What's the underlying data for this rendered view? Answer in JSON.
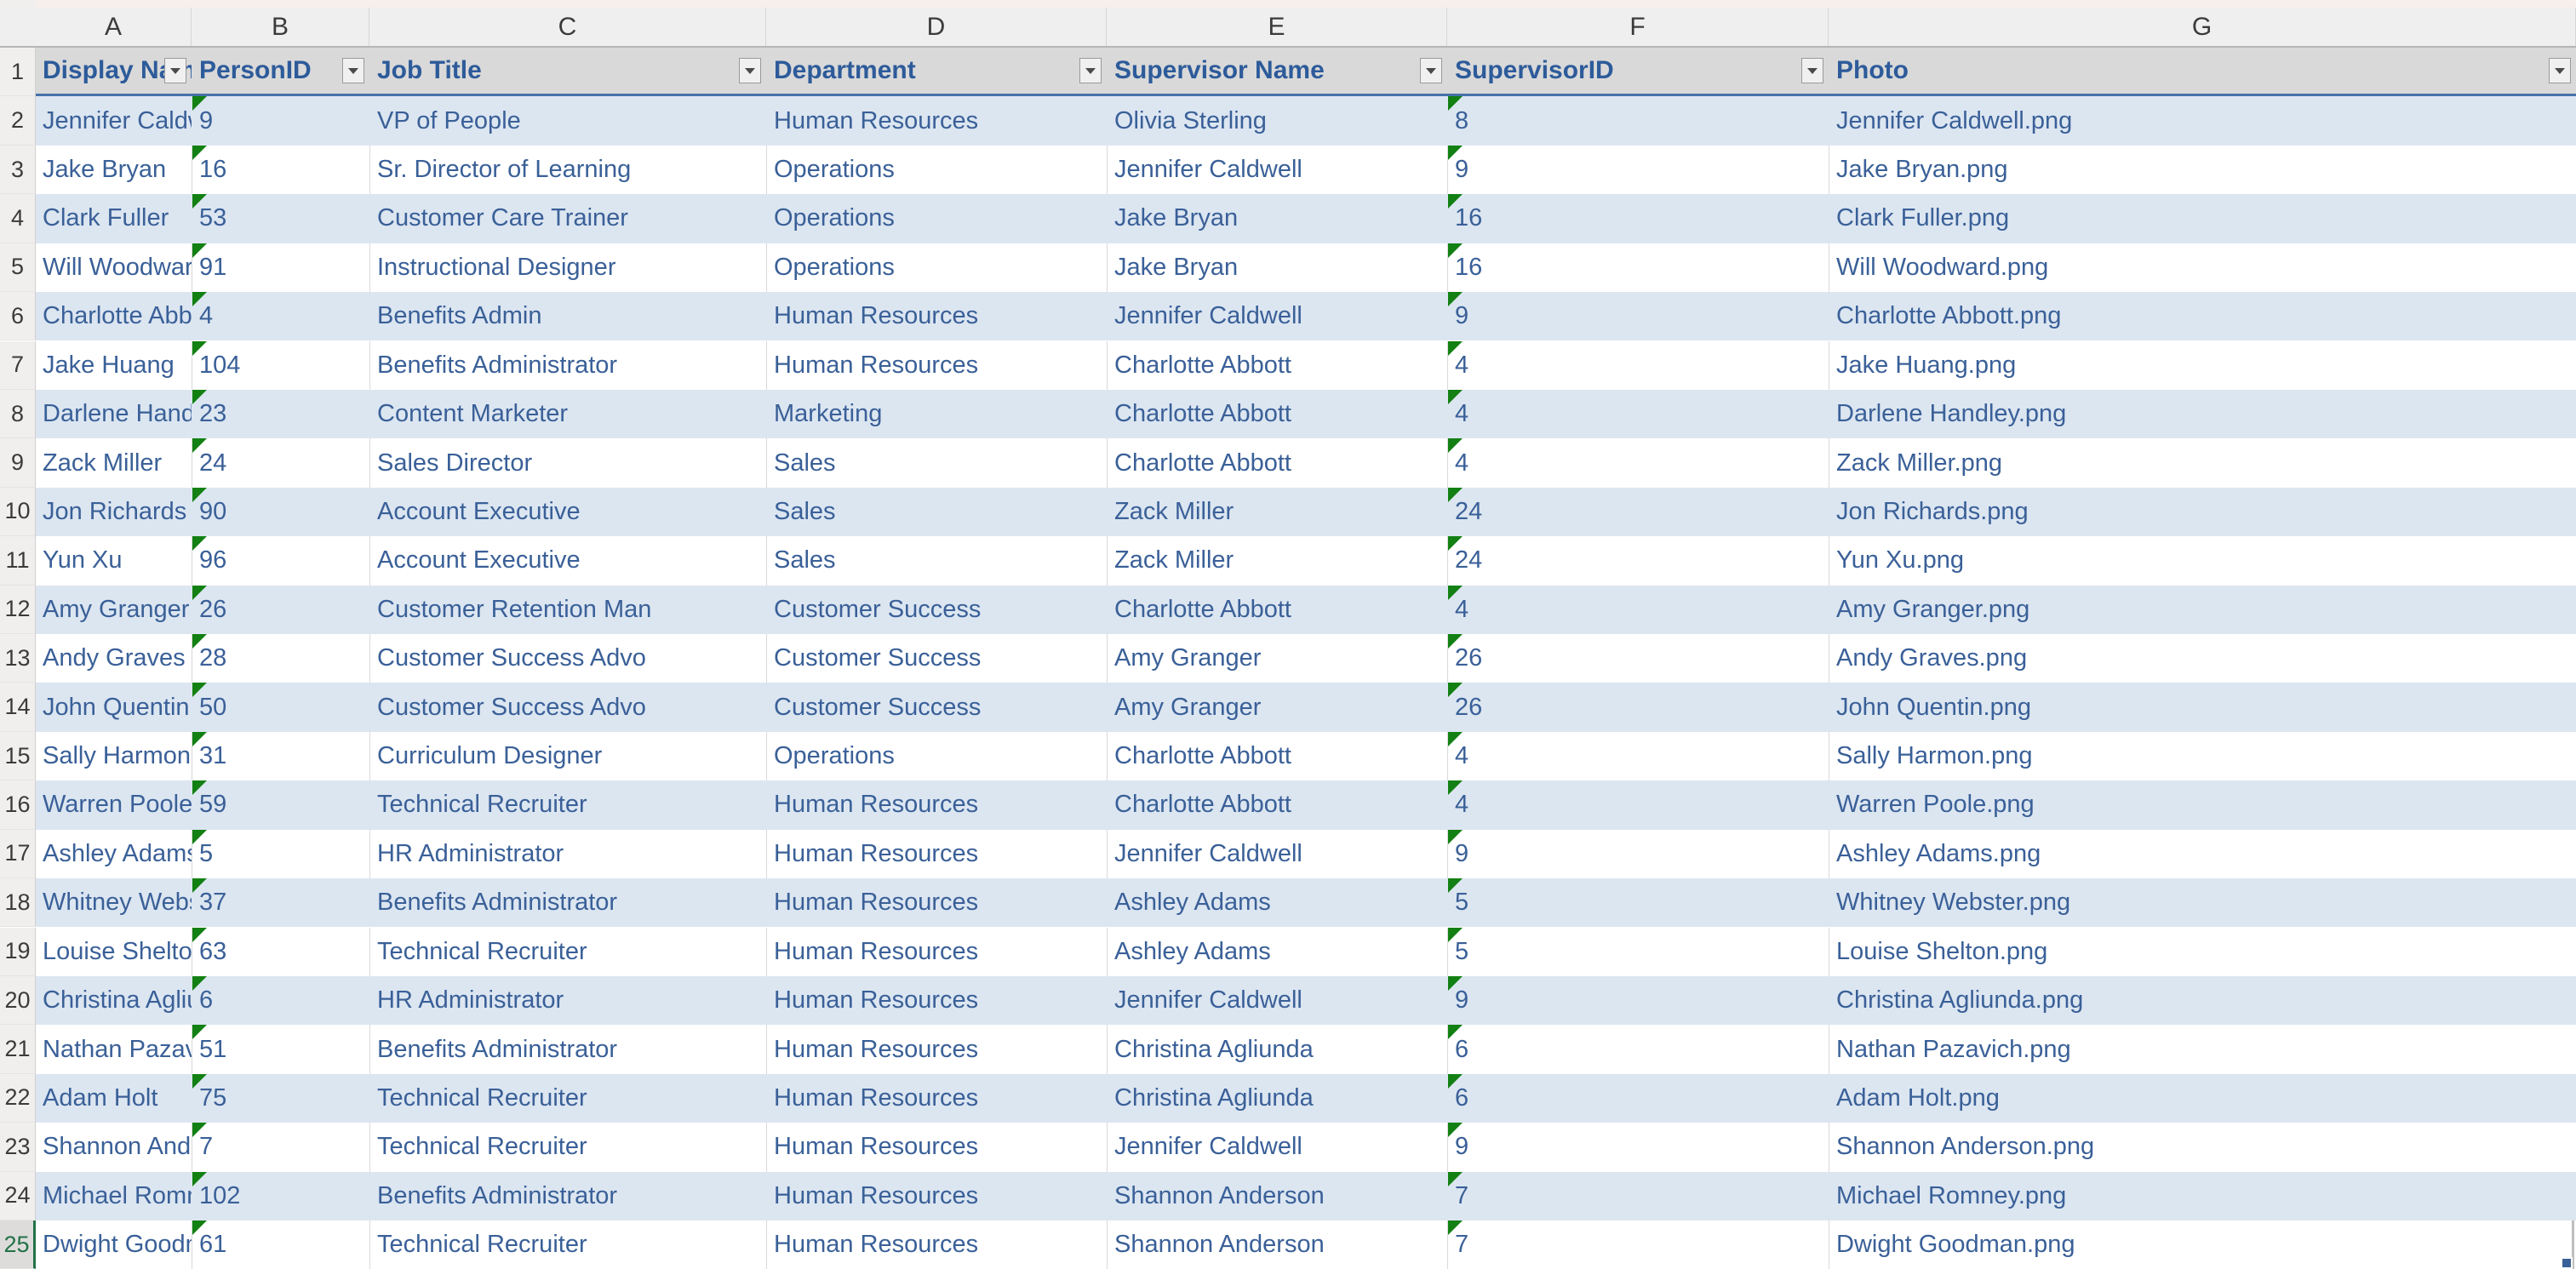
{
  "app": {
    "type": "spreadsheet"
  },
  "grid": {
    "column_letters": [
      "A",
      "B",
      "C",
      "D",
      "E",
      "F",
      "G"
    ],
    "row_numbers": [
      "1",
      "2",
      "3",
      "4",
      "5",
      "6",
      "7",
      "8",
      "9",
      "10",
      "11",
      "12",
      "13",
      "14",
      "15",
      "16",
      "17",
      "18",
      "19",
      "20",
      "21",
      "22",
      "23",
      "24",
      "25"
    ],
    "active_row": "25",
    "filter_icon": "chevron-down-icon",
    "error_marker": "green-triangle-number-stored-as-text",
    "colors": {
      "header_fill": "#D9D9D9",
      "header_text": "#2D5B9A",
      "band_fill": "#DCE6F1",
      "plain_fill": "#FFFFFF",
      "cell_text": "#3A6098",
      "header_underline": "#4472A8",
      "active_row_number": "#217346",
      "error_triangle": "#128012",
      "col_header_fill": "#EFEFEF"
    }
  },
  "table": {
    "headers": [
      "Display Name",
      "PersonID",
      "Job Title",
      "Department",
      "Supervisor Name",
      "SupervisorID",
      "Photo"
    ],
    "rows": [
      [
        "Jennifer Caldwell",
        "9",
        "VP of People",
        "Human Resources",
        "Olivia Sterling",
        "8",
        "Jennifer Caldwell.png"
      ],
      [
        "Jake Bryan",
        "16",
        "Sr. Director of Learning",
        "Operations",
        "Jennifer Caldwell",
        "9",
        "Jake Bryan.png"
      ],
      [
        "Clark Fuller",
        "53",
        "Customer Care Trainer",
        "Operations",
        "Jake Bryan",
        "16",
        "Clark Fuller.png"
      ],
      [
        "Will Woodward",
        "91",
        "Instructional Designer",
        "Operations",
        "Jake Bryan",
        "16",
        "Will Woodward.png"
      ],
      [
        "Charlotte Abbott",
        "4",
        "Benefits Admin",
        "Human Resources",
        "Jennifer Caldwell",
        "9",
        "Charlotte Abbott.png"
      ],
      [
        "Jake Huang",
        "104",
        "Benefits Administrator",
        "Human Resources",
        "Charlotte Abbott",
        "4",
        "Jake Huang.png"
      ],
      [
        "Darlene Handley",
        "23",
        "Content Marketer",
        "Marketing",
        "Charlotte Abbott",
        "4",
        "Darlene Handley.png"
      ],
      [
        "Zack Miller",
        "24",
        "Sales Director",
        "Sales",
        "Charlotte Abbott",
        "4",
        "Zack Miller.png"
      ],
      [
        "Jon Richards",
        "90",
        "Account Executive",
        "Sales",
        "Zack Miller",
        "24",
        "Jon Richards.png"
      ],
      [
        "Yun Xu",
        "96",
        "Account Executive",
        "Sales",
        "Zack Miller",
        "24",
        "Yun Xu.png"
      ],
      [
        "Amy Granger",
        "26",
        "Customer Retention Man",
        "Customer Success",
        "Charlotte Abbott",
        "4",
        "Amy Granger.png"
      ],
      [
        "Andy Graves",
        "28",
        "Customer Success Advo",
        "Customer Success",
        "Amy Granger",
        "26",
        "Andy Graves.png"
      ],
      [
        "John Quentin",
        "50",
        "Customer Success Advo",
        "Customer Success",
        "Amy Granger",
        "26",
        "John Quentin.png"
      ],
      [
        "Sally Harmon",
        "31",
        "Curriculum Designer",
        "Operations",
        "Charlotte Abbott",
        "4",
        "Sally Harmon.png"
      ],
      [
        "Warren Poole",
        "59",
        "Technical Recruiter",
        "Human Resources",
        "Charlotte Abbott",
        "4",
        "Warren Poole.png"
      ],
      [
        "Ashley Adams",
        "5",
        "HR Administrator",
        "Human Resources",
        "Jennifer Caldwell",
        "9",
        "Ashley Adams.png"
      ],
      [
        "Whitney Webster",
        "37",
        "Benefits Administrator",
        "Human Resources",
        "Ashley Adams",
        "5",
        "Whitney Webster.png"
      ],
      [
        "Louise Shelton",
        "63",
        "Technical Recruiter",
        "Human Resources",
        "Ashley Adams",
        "5",
        "Louise Shelton.png"
      ],
      [
        "Christina Agliunda",
        "6",
        "HR Administrator",
        "Human Resources",
        "Jennifer Caldwell",
        "9",
        "Christina Agliunda.png"
      ],
      [
        "Nathan Pazavich",
        "51",
        "Benefits Administrator",
        "Human Resources",
        "Christina Agliunda",
        "6",
        "Nathan Pazavich.png"
      ],
      [
        "Adam Holt",
        "75",
        "Technical Recruiter",
        "Human Resources",
        "Christina Agliunda",
        "6",
        "Adam Holt.png"
      ],
      [
        "Shannon Anderson",
        "7",
        "Technical Recruiter",
        "Human Resources",
        "Jennifer Caldwell",
        "9",
        "Shannon Anderson.png"
      ],
      [
        "Michael Romney",
        "102",
        "Benefits Administrator",
        "Human Resources",
        "Shannon Anderson",
        "7",
        "Michael Romney.png"
      ],
      [
        "Dwight Goodman",
        "61",
        "Technical Recruiter",
        "Human Resources",
        "Shannon Anderson",
        "7",
        "Dwight Goodman.png"
      ]
    ],
    "error_triangle_columns": [
      1,
      5
    ]
  }
}
